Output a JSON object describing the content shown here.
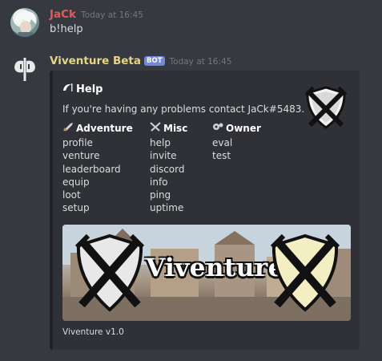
{
  "messages": [
    {
      "author": "JaCk",
      "author_color": "#e55a59",
      "timestamp": "Today at 16:45",
      "text": "b!help"
    },
    {
      "author": "Viventure Beta",
      "author_color": "#e7d583",
      "bot_tag": "BOT",
      "timestamp": "Today at 16:45"
    }
  ],
  "embed": {
    "title": "Help",
    "description": "If you're having any problems contact JaCk#5483.",
    "fields": [
      {
        "name": "Adventure",
        "icon": "dagger-icon",
        "items": [
          "profile",
          "venture",
          "leaderboard",
          "equip",
          "loot",
          "setup"
        ]
      },
      {
        "name": "Misc",
        "icon": "crossed-swords-icon",
        "items": [
          "help",
          "invite",
          "discord",
          "info",
          "ping",
          "uptime"
        ]
      },
      {
        "name": "Owner",
        "icon": "gears-icon",
        "items": [
          "eval",
          "test"
        ]
      }
    ],
    "banner_text": "Viventure",
    "footer": "Viventure v1.0"
  }
}
